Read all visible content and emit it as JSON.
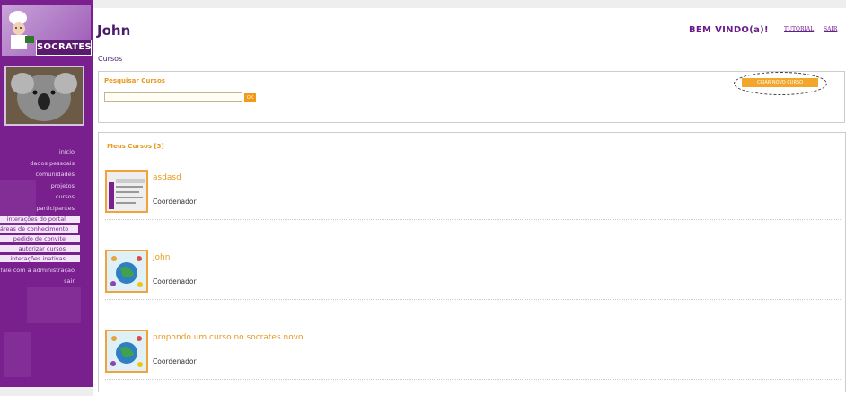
{
  "app": {
    "brand": "SOCRATES"
  },
  "header": {
    "user_name": "John",
    "welcome": "BEM VINDO(a)!",
    "tutorial_link": "TUTORIAL",
    "logout_link": "SAIR"
  },
  "section_title": "Cursos",
  "sidebar": {
    "menu": [
      {
        "label": "início",
        "style": "link"
      },
      {
        "label": "dados pessoais",
        "style": "link"
      },
      {
        "label": "comunidades",
        "style": "link"
      },
      {
        "label": "projetos",
        "style": "link"
      },
      {
        "label": "cursos",
        "style": "link"
      },
      {
        "label": "participantes",
        "style": "link"
      },
      {
        "label": "interações do portal",
        "style": "bar"
      },
      {
        "label": "áreas de conhecimento",
        "style": "bar"
      },
      {
        "label": "pedido de convite",
        "style": "bar"
      },
      {
        "label": "autorizar cursos",
        "style": "bar"
      },
      {
        "label": "interações inativas",
        "style": "bar"
      },
      {
        "label": "fale com a administração",
        "style": "link"
      },
      {
        "label": "sair",
        "style": "link"
      }
    ]
  },
  "search": {
    "label": "Pesquisar Cursos",
    "value": "",
    "ok_label": "OK"
  },
  "new_course_button": "CRIAR NOVO CURSO",
  "my_courses": {
    "title": "Meus Cursos [3]",
    "items": [
      {
        "name": "asdasd",
        "role": "Coordenador",
        "thumb": "screenshot"
      },
      {
        "name": "john",
        "role": "Coordenador",
        "thumb": "globe"
      },
      {
        "name": "propondo um curso no socrates novo",
        "role": "Coordenador",
        "thumb": "globe"
      }
    ]
  }
}
